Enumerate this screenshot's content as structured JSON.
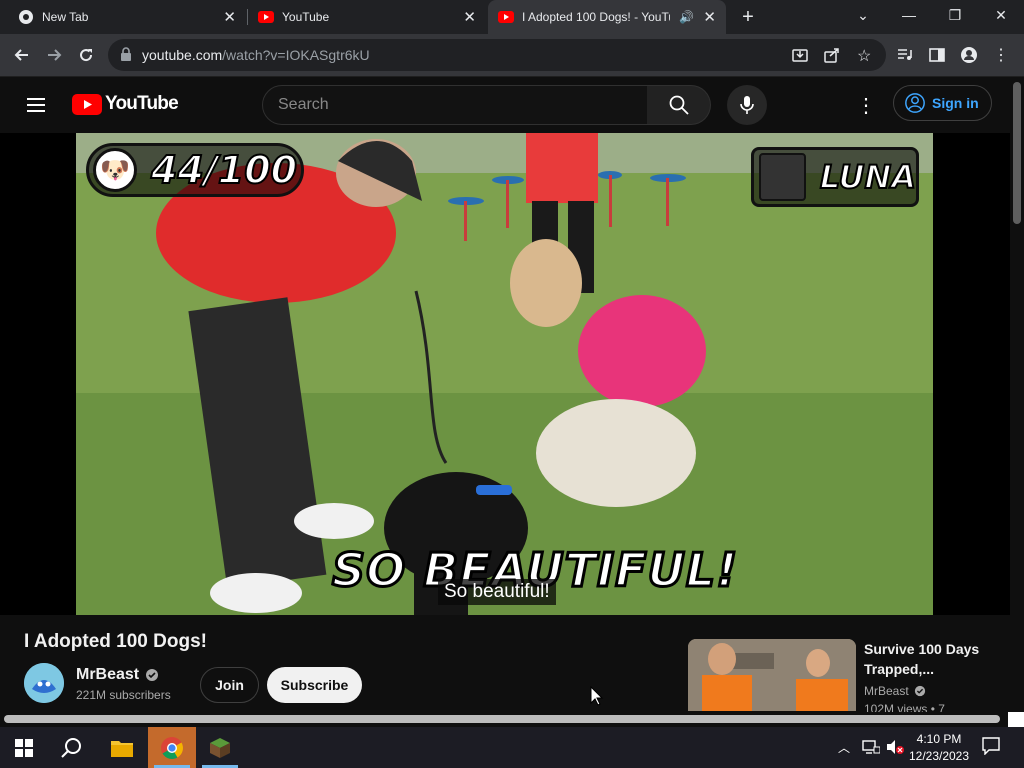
{
  "browser": {
    "tabs": [
      {
        "title": "New Tab",
        "icon": "chrome-icon"
      },
      {
        "title": "YouTube",
        "icon": "youtube-icon"
      },
      {
        "title": "I Adopted 100 Dogs! - YouTube",
        "icon": "youtube-icon",
        "active": true,
        "audio": true
      }
    ],
    "url_host": "youtube.com",
    "url_path": "/watch?v=IOKASgtr6kU"
  },
  "masthead": {
    "logo_text": "YouTube",
    "search_placeholder": "Search",
    "sign_in": "Sign in"
  },
  "video": {
    "counter": "44/100",
    "dog_name": "LUNA",
    "caption_overlay": "SO BEAUTIFUL!",
    "subtitle": "So beautiful!"
  },
  "watch": {
    "title": "I Adopted 100 Dogs!",
    "channel": "MrBeast",
    "subscribers": "221M subscribers",
    "join": "Join",
    "subscribe": "Subscribe"
  },
  "recommendation": {
    "title": "Survive 100 Days Trapped,...",
    "channel": "MrBeast",
    "meta": "102M views • 7"
  },
  "taskbar": {
    "time": "4:10 PM",
    "date": "12/23/2023"
  },
  "colors": {
    "youtube_red": "#ff0000",
    "link_blue": "#3ea6ff",
    "chrome_bg": "#202124"
  }
}
